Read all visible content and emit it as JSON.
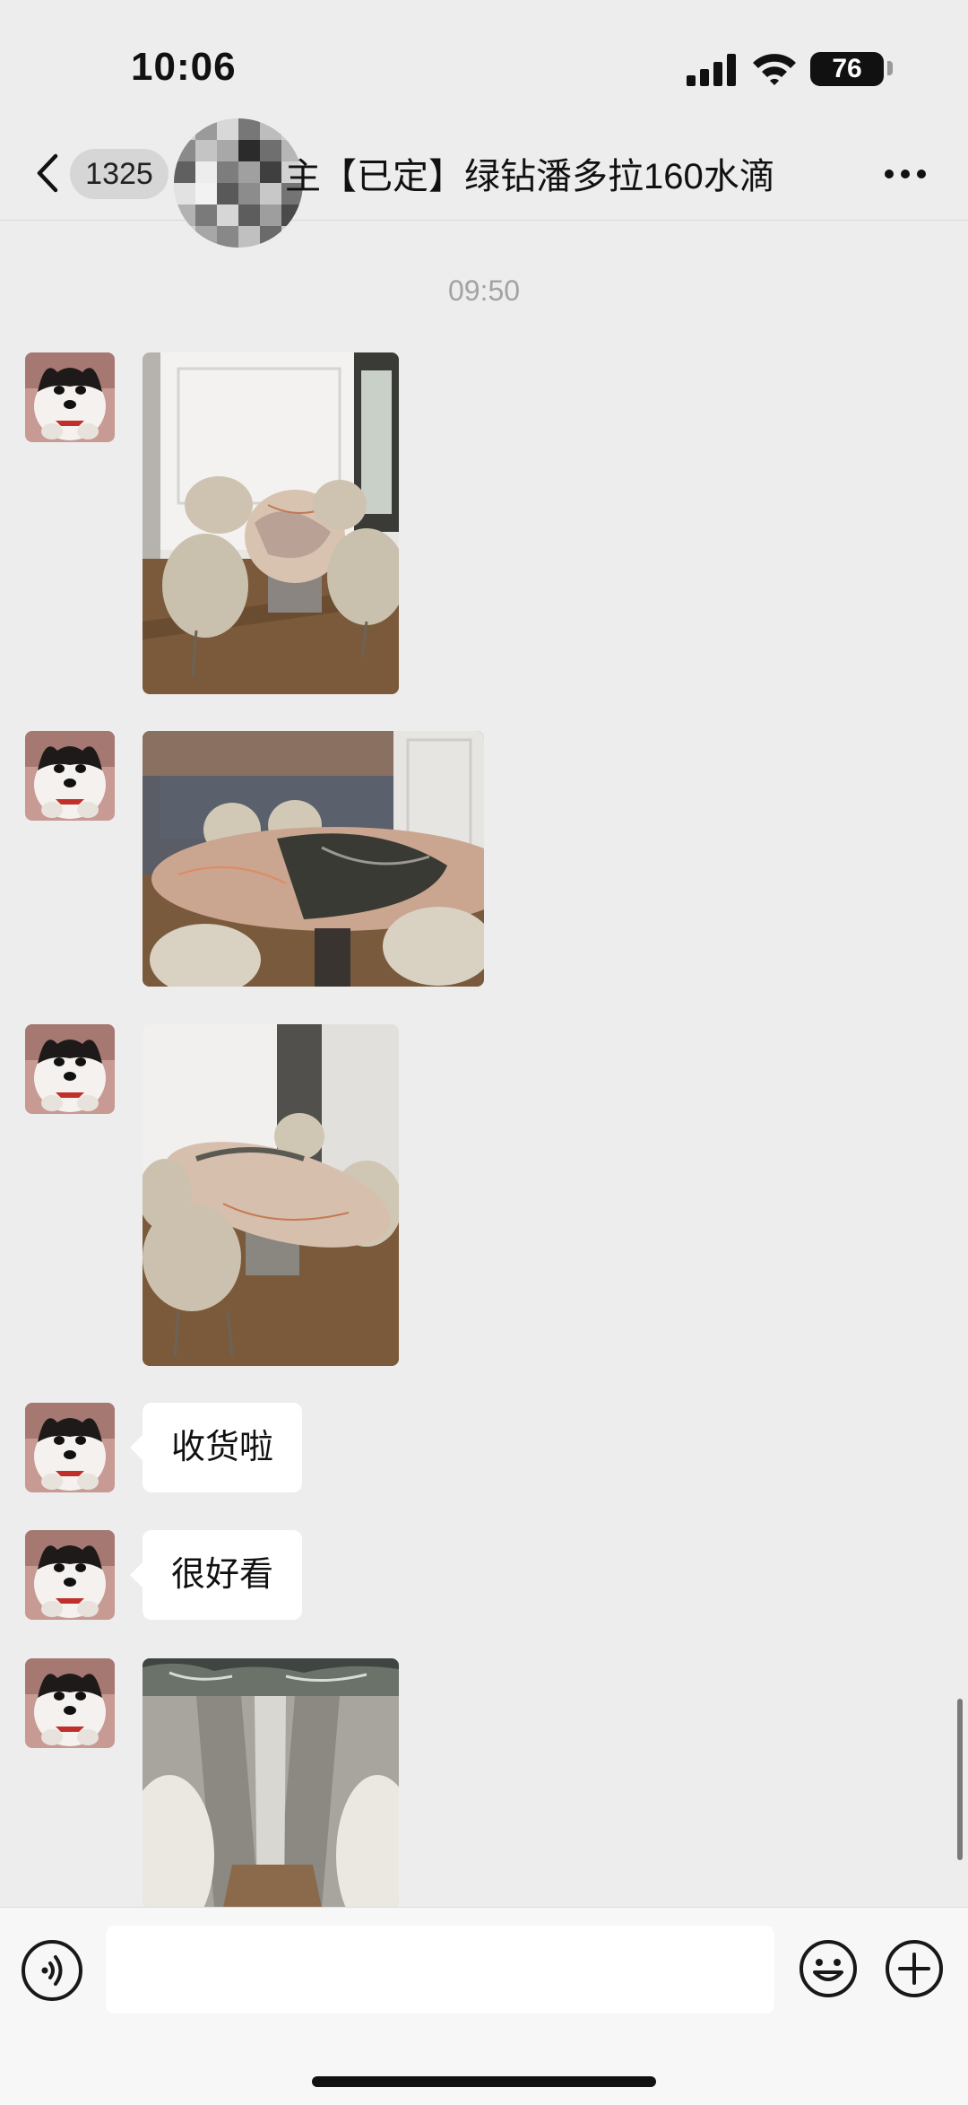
{
  "status_bar": {
    "time": "10:06",
    "battery": "76"
  },
  "nav": {
    "unread_count": "1325",
    "title": "【已定】绿钻潘多拉160水滴",
    "title_prefix_fragment": "主"
  },
  "chat": {
    "timestamp": "09:50",
    "messages": [
      {
        "type": "image",
        "description": "marble-dining-table-photo"
      },
      {
        "type": "image",
        "description": "marble-dining-table-photo"
      },
      {
        "type": "image",
        "description": "marble-dining-table-photo"
      },
      {
        "type": "text",
        "text": "收货啦"
      },
      {
        "type": "text",
        "text": "很好看"
      },
      {
        "type": "image",
        "description": "table-base-photo"
      }
    ]
  },
  "icons": {
    "back": "chevron-left-icon",
    "more": "more-dots-icon",
    "voice": "voice-icon",
    "emoji": "emoji-icon",
    "plus": "plus-icon"
  },
  "colors": {
    "background": "#ededed",
    "bubble": "#ffffff",
    "input_bar": "#f7f7f7"
  }
}
